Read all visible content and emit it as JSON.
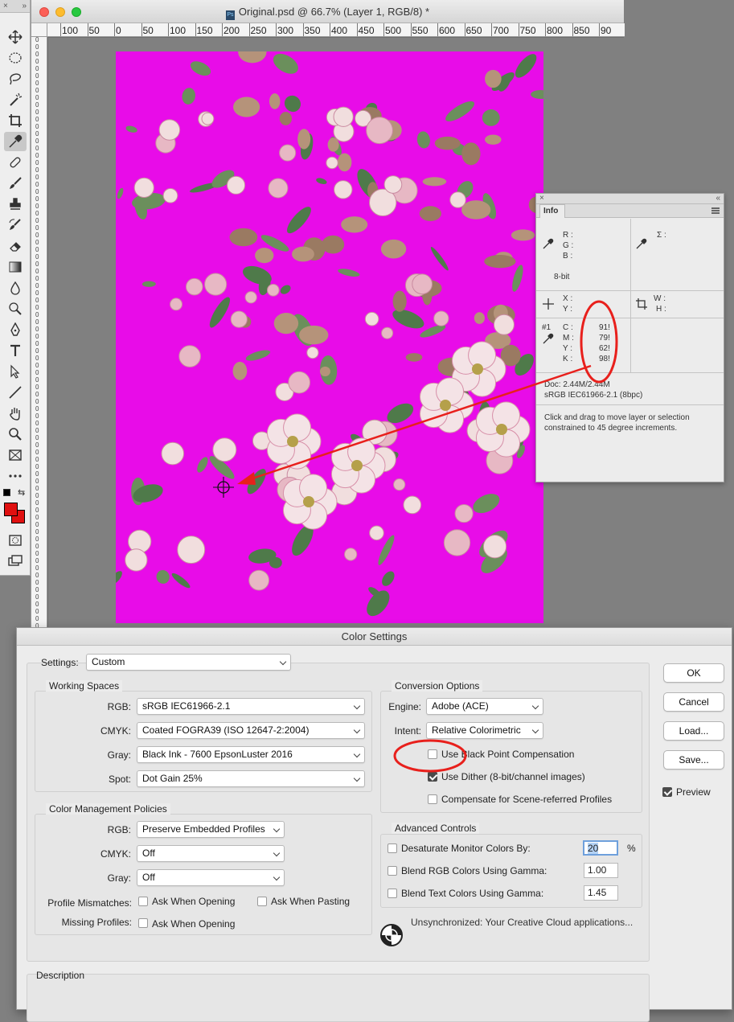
{
  "tools_panel": {
    "header_close": "×",
    "header_collapse": "»"
  },
  "document": {
    "title": "Original.psd @ 66.7% (Layer 1, RGB/8) *",
    "ps_badge": "Ps",
    "ruler_top_labels": [
      "100",
      "50",
      "0",
      "50",
      "100",
      "150",
      "200",
      "250",
      "300",
      "350",
      "400",
      "450",
      "500",
      "550",
      "600",
      "650",
      "700",
      "750",
      "800",
      "850",
      "90"
    ],
    "image_bg_color": "#e80ce8"
  },
  "info_panel": {
    "header_close": "×",
    "header_collapse": "«",
    "tab_label": "Info",
    "rgb_labels": [
      "R :",
      "G :",
      "B :"
    ],
    "bit_depth": "8-bit",
    "sigma_label": "Σ :",
    "xy_labels": [
      "X :",
      "Y :"
    ],
    "wh_labels": [
      "W :",
      "H :"
    ],
    "sample_label": "#1",
    "cmyk_labels": [
      "C :",
      "M :",
      "Y :",
      "K :"
    ],
    "cmyk_values": [
      "91!",
      "79!",
      "62!",
      "98!"
    ],
    "doc_size": "Doc: 2.44M/2.44M",
    "color_profile": "sRGB IEC61966-2.1 (8bpc)",
    "hint_text": "Click and drag to move layer or selection constrained to 45 degree increments."
  },
  "dialog": {
    "title": "Color Settings",
    "settings_label": "Settings:",
    "settings_value": "Custom",
    "working_spaces": {
      "title": "Working Spaces",
      "rgb_label": "RGB:",
      "rgb_value": "sRGB IEC61966-2.1",
      "cmyk_label": "CMYK:",
      "cmyk_value": "Coated FOGRA39 (ISO 12647-2:2004)",
      "gray_label": "Gray:",
      "gray_value": "Black Ink - 7600 EpsonLuster 2016",
      "spot_label": "Spot:",
      "spot_value": "Dot Gain 25%"
    },
    "policies": {
      "title": "Color Management Policies",
      "rgb_label": "RGB:",
      "rgb_value": "Preserve Embedded Profiles",
      "cmyk_label": "CMYK:",
      "cmyk_value": "Off",
      "gray_label": "Gray:",
      "gray_value": "Off",
      "mismatch_label": "Profile Mismatches:",
      "mismatch_open": "Ask When Opening",
      "mismatch_paste": "Ask When Pasting",
      "missing_label": "Missing Profiles:",
      "missing_open": "Ask When Opening"
    },
    "conversion": {
      "title": "Conversion Options",
      "engine_label": "Engine:",
      "engine_value": "Adobe (ACE)",
      "intent_label": "Intent:",
      "intent_value": "Relative Colorimetric",
      "bpc_label": "Use Black Point Compensation",
      "dither_label": "Use Dither (8-bit/channel images)",
      "scene_label": "Compensate for Scene-referred Profiles"
    },
    "advanced": {
      "title": "Advanced Controls",
      "desaturate_label": "Desaturate Monitor Colors By:",
      "desaturate_value": "20",
      "percent": "%",
      "blend_rgb_label": "Blend RGB Colors Using Gamma:",
      "blend_rgb_value": "1.00",
      "blend_text_label": "Blend Text Colors Using Gamma:",
      "blend_text_value": "1.45"
    },
    "sync_status": "Unsynchronized: Your Creative Cloud applications...",
    "description_title": "Description",
    "buttons": {
      "ok": "OK",
      "cancel": "Cancel",
      "load": "Load...",
      "save": "Save..."
    },
    "preview_label": "Preview"
  },
  "colors": {
    "annotation_red": "#e8201c",
    "foreground": "#e01010",
    "focus_blue": "#6ea0dc"
  }
}
